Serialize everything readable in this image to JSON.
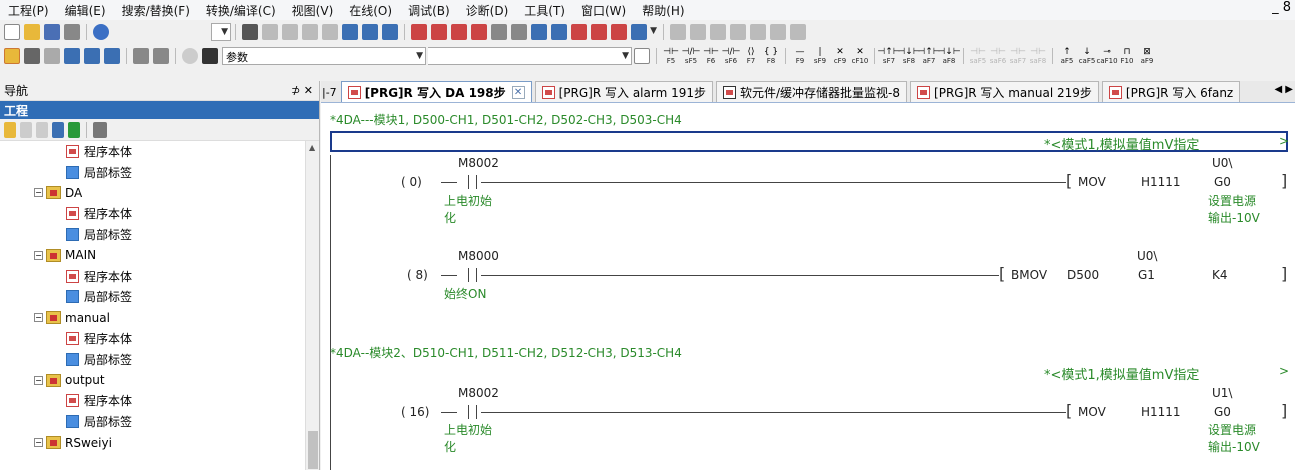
{
  "menu": [
    "工程(P)",
    "编辑(E)",
    "搜索/替换(F)",
    "转换/编译(C)",
    "视图(V)",
    "在线(O)",
    "调试(B)",
    "诊断(D)",
    "工具(T)",
    "窗口(W)",
    "帮助(H)"
  ],
  "window_controls": {
    "minimize": "_ 8"
  },
  "toolbar2": {
    "param_label": "参数"
  },
  "fkeys": [
    {
      "g": "⊣⊢",
      "k": "F5"
    },
    {
      "g": "⊣/⊢",
      "k": "sF5"
    },
    {
      "g": "⊣⊢",
      "k": "F6"
    },
    {
      "g": "⊣/⊢",
      "k": "sF6"
    },
    {
      "g": "⟨⟩",
      "k": "F7"
    },
    {
      "g": "{ }",
      "k": "F8"
    },
    {
      "g": "—",
      "k": "F9"
    },
    {
      "g": "|",
      "k": "sF9"
    },
    {
      "g": "✕",
      "k": "cF9"
    },
    {
      "g": "✕",
      "k": "cF10"
    },
    {
      "g": "⊣↑⊢",
      "k": "sF7"
    },
    {
      "g": "⊣↓⊢",
      "k": "sF8"
    },
    {
      "g": "⊣↑⊢",
      "k": "aF7"
    },
    {
      "g": "⊣↓⊢",
      "k": "aF8"
    },
    {
      "g": "⊣⊢",
      "k": "saF5",
      "gray": true
    },
    {
      "g": "⊣⊢",
      "k": "saF6",
      "gray": true
    },
    {
      "g": "⊣⊢",
      "k": "saF7",
      "gray": true
    },
    {
      "g": "⊣⊢",
      "k": "saF8",
      "gray": true
    },
    {
      "g": "↑",
      "k": "aF5"
    },
    {
      "g": "↓",
      "k": "caF5"
    },
    {
      "g": "⊸",
      "k": "caF10"
    },
    {
      "g": "⊓",
      "k": "F10"
    },
    {
      "g": "⊠",
      "k": "aF9"
    }
  ],
  "nav": {
    "title": "导航",
    "pin": "⊅ ✕",
    "sub": "工程",
    "tree": [
      {
        "type": "prog",
        "label": "程序本体",
        "indent": 1
      },
      {
        "type": "lbl",
        "label": "局部标签",
        "indent": 1
      },
      {
        "type": "folder",
        "label": "DA",
        "indent": 0
      },
      {
        "type": "prog",
        "label": "程序本体",
        "indent": 1
      },
      {
        "type": "lbl",
        "label": "局部标签",
        "indent": 1
      },
      {
        "type": "folder",
        "label": "MAIN",
        "indent": 0
      },
      {
        "type": "prog",
        "label": "程序本体",
        "indent": 1
      },
      {
        "type": "lbl",
        "label": "局部标签",
        "indent": 1
      },
      {
        "type": "folder",
        "label": "manual",
        "indent": 0
      },
      {
        "type": "prog",
        "label": "程序本体",
        "indent": 1
      },
      {
        "type": "lbl",
        "label": "局部标签",
        "indent": 1
      },
      {
        "type": "folder",
        "label": "output",
        "indent": 0
      },
      {
        "type": "prog",
        "label": "程序本体",
        "indent": 1
      },
      {
        "type": "lbl",
        "label": "局部标签",
        "indent": 1
      },
      {
        "type": "folder",
        "label": "RSweiyi",
        "indent": 0
      }
    ]
  },
  "tabs": {
    "lead": "|-7",
    "items": [
      {
        "label": "[PRG]R 写入 DA 198步",
        "active": true,
        "close": "✕"
      },
      {
        "label": "[PRG]R 写入 alarm 191步"
      },
      {
        "label": "软元件/缓冲存储器批量监视-8",
        "mon": true
      },
      {
        "label": "[PRG]R 写入 manual 219步"
      },
      {
        "label": "[PRG]R 写入 6fanz"
      }
    ],
    "arrows": "◀ ▶"
  },
  "ladder": {
    "comment1": "*4DA---模块1, D500-CH1, D501-CH2, D502-CH3, D503-CH4",
    "note1": "*<模式1,模拟量值mV指定",
    "rung1": {
      "step": "(   0)",
      "contact": "M8002",
      "contact_comment": [
        "上电初始",
        "化"
      ],
      "instr": "MOV",
      "op1": "H1111",
      "op2": "U0\\",
      "op2b": "G0",
      "dst_comment": [
        "设置电源",
        "输出-10V"
      ]
    },
    "rung2": {
      "step": "(   8)",
      "contact": "M8000",
      "contact_comment": [
        "始终ON"
      ],
      "instr": "BMOV",
      "op1": "D500",
      "op2": "U0\\",
      "op2b": "G1",
      "op3": "K4"
    },
    "comment2": "*4DA--模块2、D510-CH1, D511-CH2, D512-CH3, D513-CH4",
    "note2": "*<模式1,模拟量值mV指定",
    "rung3": {
      "step": "(  16)",
      "contact": "M8002",
      "contact_comment": [
        "上电初始",
        "化"
      ],
      "instr": "MOV",
      "op1": "H1111",
      "op2": "U1\\",
      "op2b": "G0",
      "dst_comment": [
        "设置电源",
        "输出-10V"
      ]
    },
    "gt": ">"
  }
}
